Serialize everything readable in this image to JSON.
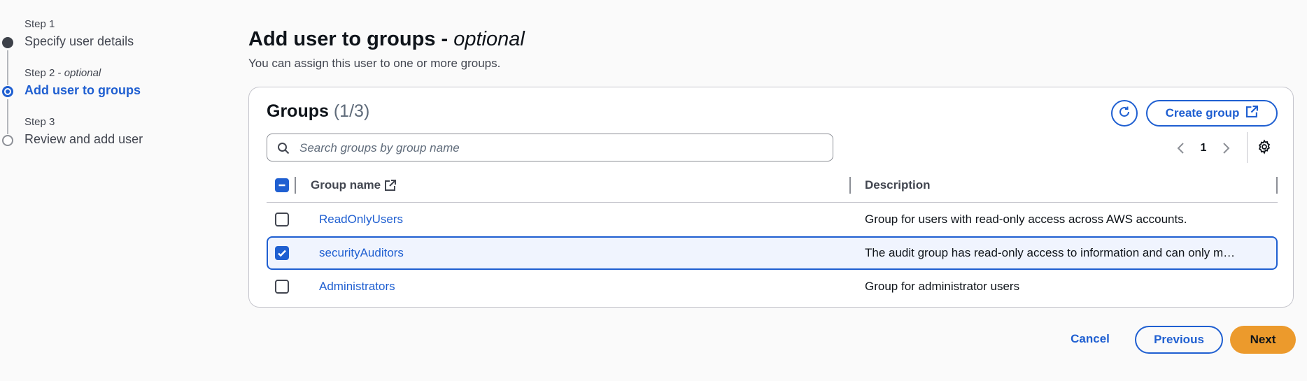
{
  "stepper": {
    "steps": [
      {
        "small": "Step 1",
        "title": "Specify user details"
      },
      {
        "small": "Step 2",
        "small_suffix": "optional",
        "title": "Add user to groups"
      },
      {
        "small": "Step 3",
        "title": "Review and add user"
      }
    ]
  },
  "header": {
    "title": "Add user to groups -",
    "title_suffix": "optional",
    "subtitle": "You can assign this user to one or more groups."
  },
  "groups": {
    "title": "Groups",
    "count": "(1/3)",
    "create_label": "Create group",
    "search_placeholder": "Search groups by group name",
    "page": "1",
    "columns": {
      "name": "Group name",
      "description": "Description"
    },
    "rows": [
      {
        "name": "ReadOnlyUsers",
        "description": "Group for users with read-only access across AWS accounts.",
        "selected": false
      },
      {
        "name": "securityAuditors",
        "description": "The audit group has read-only access to information and can only m…",
        "selected": true
      },
      {
        "name": "Administrators",
        "description": "Group for administrator users",
        "selected": false
      }
    ]
  },
  "footer": {
    "cancel": "Cancel",
    "previous": "Previous",
    "next": "Next"
  },
  "icons": {
    "refresh": "refresh-icon",
    "external": "external-link-icon",
    "search": "search-icon",
    "settings": "gear-icon"
  },
  "colors": {
    "accent": "#1f5fd1",
    "primary_button": "#ec9a2c",
    "selected_row_bg": "#f0f4fe"
  }
}
